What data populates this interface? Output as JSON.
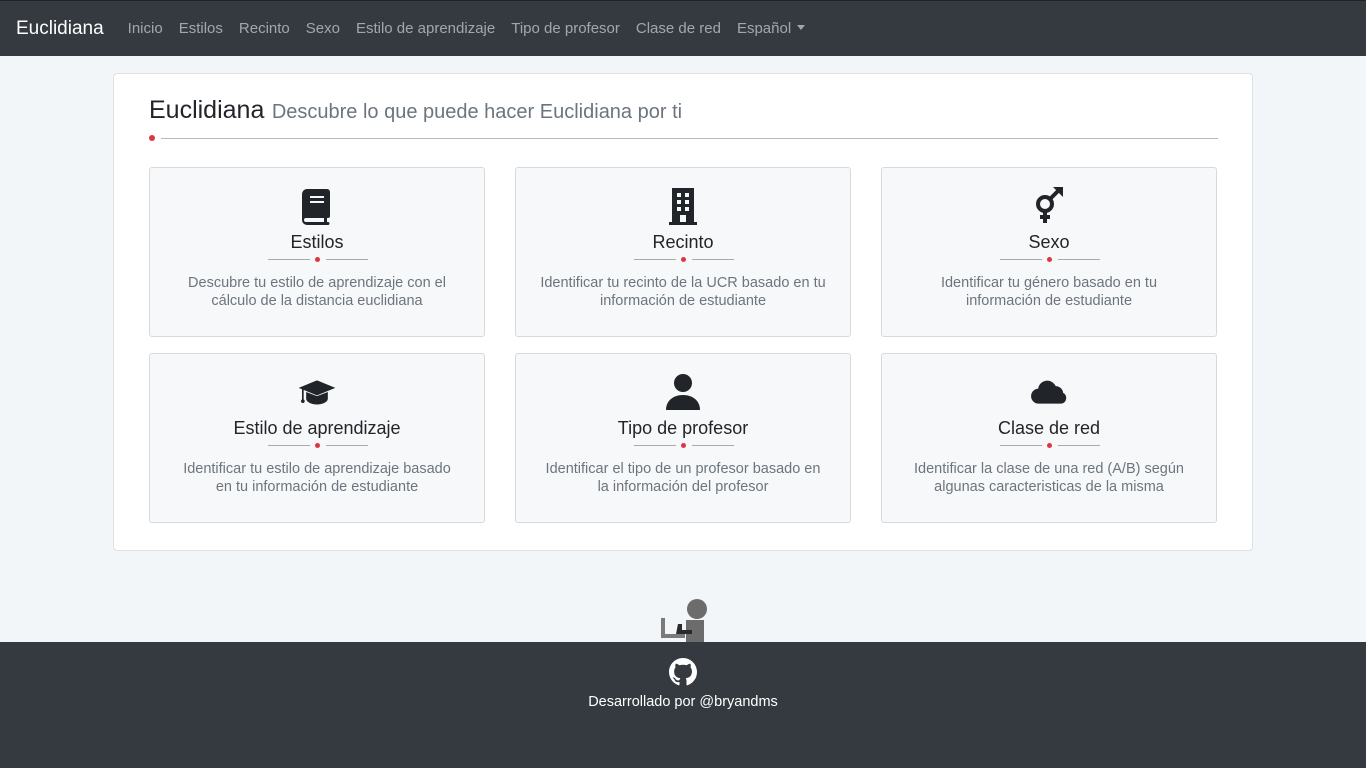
{
  "navbar": {
    "brand": "Euclidiana",
    "links": [
      "Inicio",
      "Estilos",
      "Recinto",
      "Sexo",
      "Estilo de aprendizaje",
      "Tipo de profesor",
      "Clase de red"
    ],
    "language": "Español"
  },
  "heading": {
    "title": "Euclidiana",
    "subtitle": "Descubre lo que puede hacer Euclidiana por ti"
  },
  "features": [
    {
      "icon": "book-icon",
      "title": "Estilos",
      "description": "Descubre tu estilo de aprendizaje con el cálculo de la distancia euclidiana"
    },
    {
      "icon": "building-icon",
      "title": "Recinto",
      "description": "Identificar tu recinto de la UCR basado en tu información de estudiante"
    },
    {
      "icon": "transgender-icon",
      "title": "Sexo",
      "description": "Identificar tu género basado en tu información de estudiante"
    },
    {
      "icon": "graduation-cap-icon",
      "title": "Estilo de aprendizaje",
      "description": "Identificar tu estilo de aprendizaje basado en tu información de estudiante"
    },
    {
      "icon": "user-icon",
      "title": "Tipo de profesor",
      "description": "Identificar el tipo de un profesor basado en la información del profesor"
    },
    {
      "icon": "cloud-icon",
      "title": "Clase de red",
      "description": "Identificar la clase de una red (A/B) según algunas caracteristicas de la misma"
    }
  ],
  "footer": {
    "credit": "Desarrollado por @bryandms",
    "icon": "github-icon"
  },
  "colors": {
    "navbar_bg": "#343a40",
    "accent_dot": "#dc3545",
    "page_bg": "#f3f6f9"
  }
}
